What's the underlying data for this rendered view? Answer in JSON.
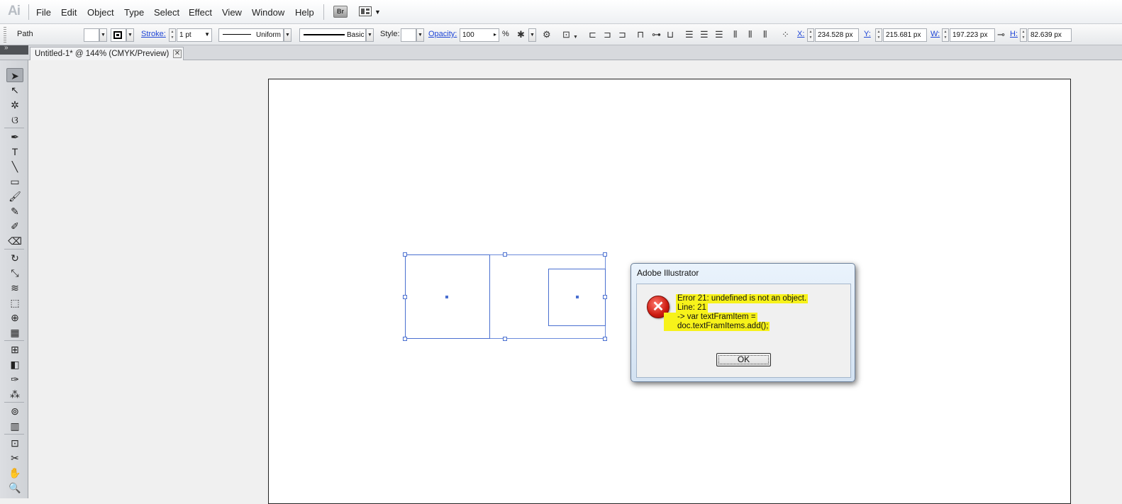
{
  "app": {
    "logo": "Ai"
  },
  "menu": {
    "items": [
      "File",
      "Edit",
      "Object",
      "Type",
      "Select",
      "Effect",
      "View",
      "Window",
      "Help"
    ],
    "bridge_label": "Br"
  },
  "control": {
    "selection_type": "Path",
    "stroke_label": "Stroke:",
    "stroke_weight": "1 pt",
    "profile": "Uniform",
    "brush": "Basic",
    "style_label": "Style:",
    "opacity_label": "Opacity:",
    "opacity_value": "100",
    "opacity_unit": "%",
    "x_label": "X:",
    "x_value": "234.528 px",
    "y_label": "Y:",
    "y_value": "215.681 px",
    "w_label": "W:",
    "w_value": "197.223 px",
    "h_label": "H:",
    "h_value": "82.639 px"
  },
  "document": {
    "tab_title": "Untitled-1* @ 144% (CMYK/Preview)",
    "close_glyph": "✕"
  },
  "tools": [
    {
      "name": "selection-tool",
      "glyph": "➤"
    },
    {
      "name": "direct-selection-tool",
      "glyph": "↖"
    },
    {
      "name": "magic-wand-tool",
      "glyph": "✲"
    },
    {
      "name": "lasso-tool",
      "glyph": "ଓ"
    },
    {
      "name": "pen-tool",
      "glyph": "✒"
    },
    {
      "name": "type-tool",
      "glyph": "T"
    },
    {
      "name": "line-tool",
      "glyph": "╲"
    },
    {
      "name": "rectangle-tool",
      "glyph": "▭"
    },
    {
      "name": "paintbrush-tool",
      "glyph": "🖌"
    },
    {
      "name": "pencil-tool",
      "glyph": "✎"
    },
    {
      "name": "blob-brush-tool",
      "glyph": "✐"
    },
    {
      "name": "eraser-tool",
      "glyph": "⌫"
    },
    {
      "name": "rotate-tool",
      "glyph": "↻"
    },
    {
      "name": "scale-tool",
      "glyph": "⤡"
    },
    {
      "name": "warp-tool",
      "glyph": "≋"
    },
    {
      "name": "free-transform-tool",
      "glyph": "⬚"
    },
    {
      "name": "shape-builder-tool",
      "glyph": "⊕"
    },
    {
      "name": "perspective-grid-tool",
      "glyph": "▦"
    },
    {
      "name": "mesh-tool",
      "glyph": "⊞"
    },
    {
      "name": "gradient-tool",
      "glyph": "◧"
    },
    {
      "name": "eyedropper-tool",
      "glyph": "✑"
    },
    {
      "name": "blend-tool",
      "glyph": "⁂"
    },
    {
      "name": "symbol-sprayer-tool",
      "glyph": "⊚"
    },
    {
      "name": "column-graph-tool",
      "glyph": "▥"
    },
    {
      "name": "artboard-tool",
      "glyph": "⊡"
    },
    {
      "name": "slice-tool",
      "glyph": "✂"
    },
    {
      "name": "hand-tool",
      "glyph": "✋"
    },
    {
      "name": "zoom-tool",
      "glyph": "🔍"
    }
  ],
  "dialog": {
    "title": "Adobe Illustrator",
    "icon": "error-icon",
    "icon_glyph": "✕",
    "lines": [
      "Error 21: undefined is not an object.",
      "Line: 21",
      "-> var textFramItem =",
      "doc.textFramItems.add();"
    ],
    "ok_label": "OK"
  },
  "colors": {
    "selection": "#4a6fd0",
    "highlight": "#f7f21a",
    "error": "#cc1a10"
  }
}
